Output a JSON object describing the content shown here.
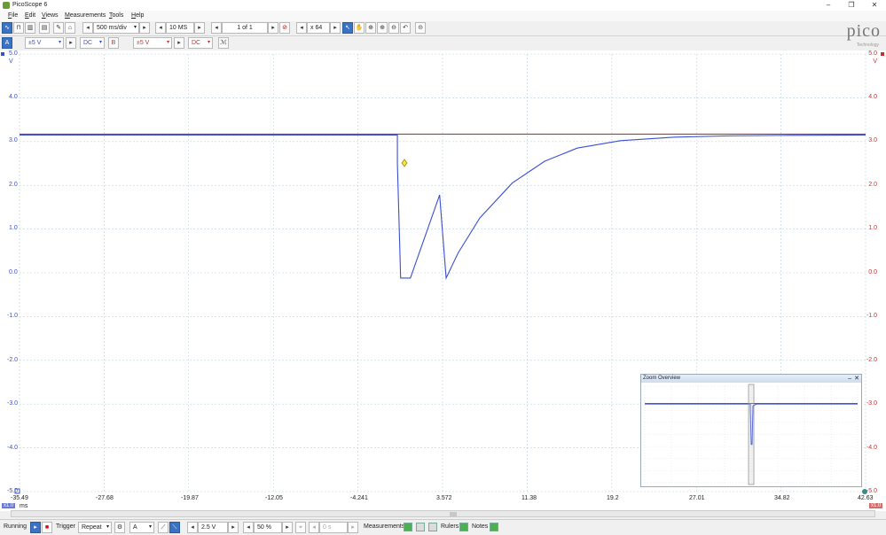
{
  "window": {
    "title": "PicoScope 6",
    "minimize": "–",
    "maximize": "❐",
    "close": "✕"
  },
  "menu": [
    "File",
    "Edit",
    "Views",
    "Measurements",
    "Tools",
    "Help"
  ],
  "toolbar": {
    "timebase": "500 ms/div",
    "samples": "10 MS",
    "buffer": "1 of 1",
    "zoom": "x 64"
  },
  "channels": {
    "a": {
      "label": "A",
      "range": "±5 V",
      "coupling": "DC",
      "color": "#3a4fd0"
    },
    "b": {
      "label": "B",
      "range": "±5 V",
      "coupling": "DC",
      "color": "#c83030"
    }
  },
  "logo": {
    "name": "pico",
    "subtitle": "Technology"
  },
  "axes": {
    "y_ticks": [
      "5.0",
      "4.0",
      "3.0",
      "2.0",
      "1.0",
      "0.0",
      "-1.0",
      "-2.0",
      "-3.0",
      "-4.0",
      "-5.0"
    ],
    "y_unit": "V",
    "x_ticks": [
      "-35.49",
      "-27.68",
      "-19.87",
      "-12.05",
      "-4.241",
      "3.572",
      "11.38",
      "19.2",
      "27.01",
      "34.82",
      "42.63"
    ],
    "x_unit": "ms",
    "scale_left": "x1.0",
    "scale_right": "x1.0"
  },
  "chart_data": {
    "type": "line",
    "xlim": [
      -35.49,
      42.63
    ],
    "ylim": [
      -5,
      5
    ],
    "series": [
      {
        "channel": "A",
        "color": "#3a4fd0",
        "points": [
          [
            -35.49,
            3.15
          ],
          [
            -0.6,
            3.15
          ],
          [
            -0.6,
            2.5
          ],
          [
            -0.3,
            -0.12
          ],
          [
            0.6,
            -0.12
          ],
          [
            3.3,
            1.78
          ],
          [
            3.3,
            1.78
          ],
          [
            3.9,
            -0.12
          ],
          [
            5,
            0.45
          ],
          [
            7,
            1.25
          ],
          [
            10,
            2.05
          ],
          [
            13,
            2.55
          ],
          [
            16,
            2.85
          ],
          [
            20,
            3.02
          ],
          [
            25,
            3.1
          ],
          [
            30,
            3.13
          ],
          [
            35,
            3.14
          ],
          [
            42.63,
            3.15
          ]
        ]
      },
      {
        "channel": "B",
        "color": "#c83030",
        "points": [
          [
            -35.49,
            3.17
          ],
          [
            42.63,
            3.17
          ]
        ]
      }
    ]
  },
  "zoom_overview": {
    "title": "Zoom Overview",
    "minimize": "–",
    "close": "✕"
  },
  "status": {
    "state": "Running",
    "trigger_label": "Trigger",
    "trigger_mode": "Repeat",
    "trigger_source": "A",
    "threshold": "2.5 V",
    "pretrigger": "50 %",
    "delay": "0 s",
    "measurements": "Measurements",
    "rulers": "Rulers",
    "notes": "Notes"
  }
}
